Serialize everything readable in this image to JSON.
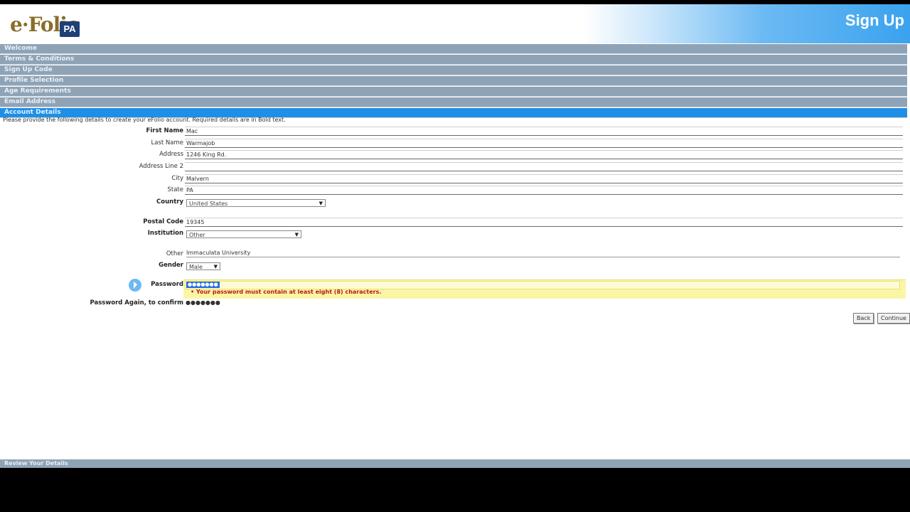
{
  "header": {
    "logo_text": "e·Folio",
    "logo_badge": "PA",
    "page_title": "Sign Up"
  },
  "nav": {
    "items": [
      {
        "label": "Welcome"
      },
      {
        "label": "Terms & Conditions"
      },
      {
        "label": "Sign Up Code"
      },
      {
        "label": "Profile Selection"
      },
      {
        "label": "Age Requirements"
      },
      {
        "label": "Email Address"
      },
      {
        "label": "Account Details"
      }
    ]
  },
  "form": {
    "intro": "Please provide the following details to create your eFolio account. Required details are in Bold text.",
    "first_name": {
      "label": "First Name",
      "value": "Mac"
    },
    "last_name": {
      "label": "Last Name",
      "value": "Warmajob"
    },
    "address": {
      "label": "Address",
      "value": "1246 King Rd."
    },
    "address2": {
      "label": "Address Line 2",
      "value": ""
    },
    "city": {
      "label": "City",
      "value": "Malvern"
    },
    "state": {
      "label": "State",
      "value": "PA"
    },
    "country": {
      "label": "Country",
      "value": "United States"
    },
    "postal_code": {
      "label": "Postal Code",
      "value": "19345"
    },
    "institution": {
      "label": "Institution",
      "value": "Other"
    },
    "ucc": {
      "label": "Other",
      "value": "Immaculata University"
    },
    "gender": {
      "label": "Gender",
      "value": "Male"
    },
    "password": {
      "label": "Password",
      "value": "●●●●●●●",
      "error": "• Your password must contain at least eight (8) characters."
    },
    "password_confirm": {
      "label": "Password Again, to confirm",
      "value": "●●●●●●●"
    }
  },
  "buttons": {
    "back": "Back",
    "continue": "Continue"
  },
  "footer": {
    "next_step": "Review Your Details"
  }
}
